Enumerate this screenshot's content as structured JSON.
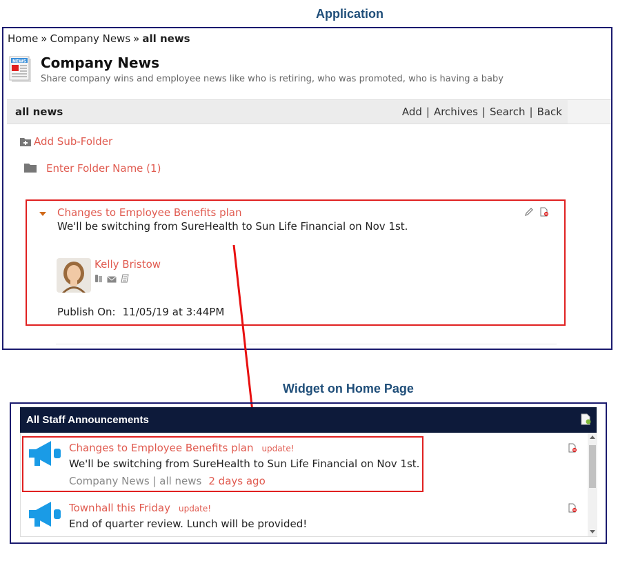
{
  "labels": {
    "application": "Application",
    "widget": "Widget on Home Page"
  },
  "breadcrumb": {
    "home": "Home",
    "parent": "Company News",
    "current": "all news",
    "separator": "»"
  },
  "page": {
    "title": "Company News",
    "subtitle": "Share company wins and employee news like who is retiring, who was promoted, who is having a baby",
    "icon": "news-icon"
  },
  "toolbar": {
    "label": "all news",
    "links": [
      "Add",
      "Archives",
      "Search",
      "Back"
    ]
  },
  "folders": {
    "add_subfolder": "Add Sub-Folder",
    "folder_name": "Enter Folder Name (1)"
  },
  "article": {
    "title": "Changes to Employee Benefits plan",
    "body": "We'll be switching from SureHealth to Sun Life Financial on Nov 1st.",
    "author": "Kelly Bristow",
    "publish_label": "Publish On:",
    "publish_value": "11/05/19 at 3:44PM"
  },
  "widget": {
    "title": "All Staff Announcements",
    "items": [
      {
        "title": "Changes to Employee Benefits plan",
        "badge": "update!",
        "body": "We'll be switching from SureHealth to Sun Life Financial on Nov 1st.",
        "source": "Company News | all news",
        "ago": "2 days ago"
      },
      {
        "title": "Townhall this Friday",
        "badge": "update!",
        "body": "End of quarter review. Lunch will be provided!"
      }
    ]
  },
  "colors": {
    "link": "#e05a4f",
    "frame": "#1a1a6e",
    "highlight": "#e02020",
    "header_bg": "#0d1a3a",
    "megaphone": "#1a9be6"
  }
}
